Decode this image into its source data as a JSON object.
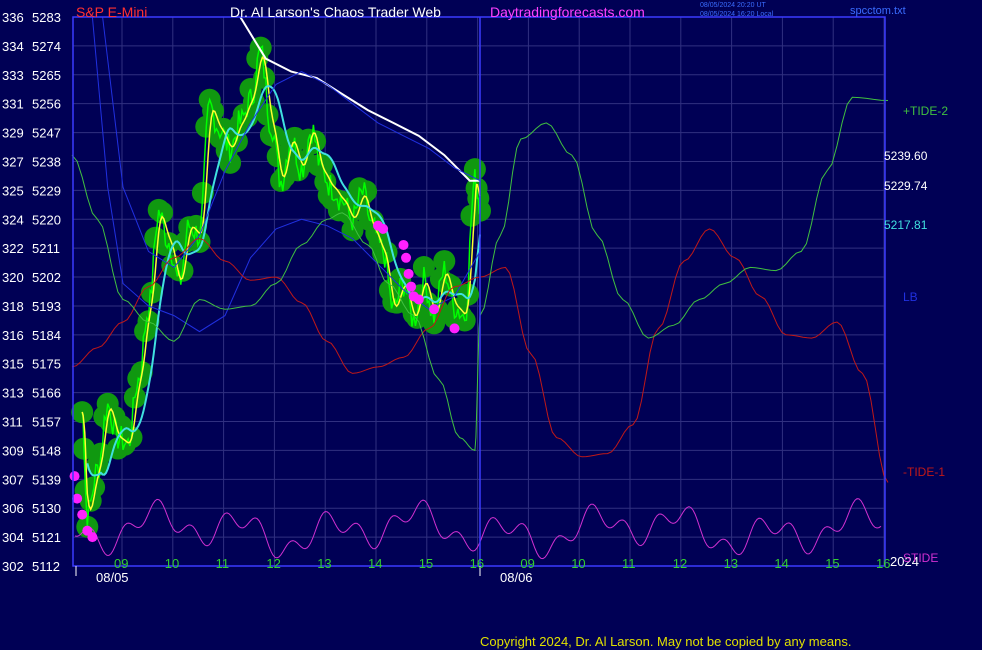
{
  "header": {
    "symbol": "S&P E-Mini",
    "author": "Dr. Al Larson's Chaos Trader Web",
    "site": "Daytradingforecasts.com",
    "timestamp_1": "08/05/2024 20:20 UT",
    "timestamp_2": "08/05/2024 16:20 Local",
    "file": "spcctom.txt"
  },
  "copyright": "Copyright 2024, Dr. Al Larson. May not be copied by any means.",
  "colors": {
    "background": "#000055",
    "grid": "#303080",
    "border": "#3a3aff",
    "price": "#00ff00",
    "price_band": "#109810",
    "fast_avg": "#ffff30",
    "slow_avg": "#40e0e0",
    "long_avg": "#ffffff",
    "tide_plus": "#40c040",
    "tide_minus": "#c01818",
    "stide": "#d030d0",
    "lb": "#2030e0",
    "marker": "#ff20ff"
  },
  "chart_data": {
    "type": "line",
    "title": "S&P E-Mini",
    "y_ticks_left": [
      "336",
      "334",
      "333",
      "331",
      "329",
      "327",
      "325",
      "324",
      "322",
      "320",
      "318",
      "316",
      "315",
      "313",
      "311",
      "309",
      "307",
      "306",
      "304",
      "302"
    ],
    "y_ticks_price": [
      "5283",
      "5274",
      "5265",
      "5256",
      "5247",
      "5238",
      "5229",
      "5220",
      "5211",
      "5202",
      "5193",
      "5184",
      "5175",
      "5166",
      "5157",
      "5148",
      "5139",
      "5130",
      "5121",
      "5112"
    ],
    "ylim": [
      5112,
      5283
    ],
    "x_ticks": [
      "09",
      "10",
      "11",
      "12",
      "13",
      "14",
      "15",
      "16",
      "09",
      "10",
      "11",
      "12",
      "13",
      "14",
      "15",
      "16"
    ],
    "date_labels": [
      "08/05",
      "08/06"
    ],
    "year_label": "2024",
    "right_labels": {
      "tide2": "+TIDE-2",
      "lb": "LB",
      "tide1": "-TIDE-1",
      "stide": "STIDE",
      "value_white": "5239.60",
      "value_yellow": "5229.74",
      "value_cyan": "5217.81"
    },
    "series": [
      {
        "name": "S&P E-Mini",
        "x": [
          8.2,
          8.3,
          8.5,
          8.7,
          8.9,
          9.1,
          9.3,
          9.5,
          9.7,
          9.9,
          10.1,
          10.3,
          10.5,
          10.7,
          10.9,
          11.1,
          11.3,
          11.5,
          11.7,
          11.9,
          12.1,
          12.3,
          12.5,
          12.7,
          12.9,
          13.1,
          13.3,
          13.5,
          13.7,
          13.9,
          14.1,
          14.3,
          14.5,
          14.7,
          14.9,
          15.1,
          15.3,
          15.5,
          15.7,
          15.9,
          16.0
        ],
        "values": [
          5160,
          5128,
          5142,
          5162,
          5152,
          5150,
          5170,
          5192,
          5222,
          5213,
          5200,
          5218,
          5215,
          5255,
          5248,
          5242,
          5250,
          5257,
          5272,
          5250,
          5232,
          5245,
          5236,
          5248,
          5235,
          5230,
          5226,
          5220,
          5228,
          5217,
          5210,
          5192,
          5200,
          5189,
          5201,
          5190,
          5204,
          5193,
          5190,
          5232,
          5226
        ]
      },
      {
        "name": "-TIDE-1",
        "x": [
          8.0,
          8.5,
          9.0,
          9.5,
          10.0,
          10.5,
          11.0,
          11.5,
          12.0,
          12.5,
          13.0,
          13.5,
          14.0,
          14.5,
          15.0,
          15.5,
          16.0,
          16.5,
          17.0,
          17.5,
          18.0,
          18.5,
          19.0,
          19.5,
          20.0,
          20.5,
          21.0,
          21.5,
          22.0,
          22.5,
          23.0,
          23.5,
          24.0
        ],
        "values": [
          5174,
          5180,
          5188,
          5199,
          5208,
          5214,
          5207,
          5201,
          5202,
          5194,
          5182,
          5172,
          5174,
          5177,
          5186,
          5199,
          5202,
          5205,
          5178,
          5152,
          5146,
          5147,
          5156,
          5186,
          5207,
          5217,
          5208,
          5196,
          5184,
          5183,
          5188,
          5172,
          5138
        ]
      }
    ]
  }
}
